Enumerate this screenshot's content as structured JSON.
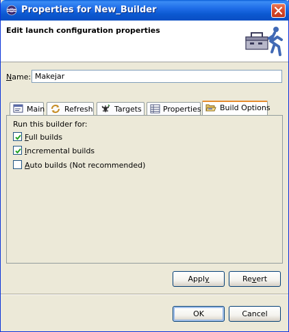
{
  "window": {
    "title": "Properties for New_Builder"
  },
  "header": {
    "title": "Edit launch configuration properties",
    "graphic_icon": "builder-launch-icon"
  },
  "name_field": {
    "label_mnemonic": "N",
    "label_rest": "ame:",
    "value": "Makejar"
  },
  "tabs": [
    {
      "label": "Main",
      "icon": "main-tab-icon",
      "active": false
    },
    {
      "label": "Refresh",
      "icon": "refresh-icon",
      "active": false
    },
    {
      "label": "Targets",
      "icon": "targets-icon",
      "active": false
    },
    {
      "label": "Properties",
      "icon": "properties-icon",
      "active": false
    },
    {
      "label": "Build Options",
      "icon": "folder-open-icon",
      "active": true
    }
  ],
  "build_options": {
    "heading": "Run this builder for:",
    "options": [
      {
        "mnemonic": "F",
        "rest": "ull builds",
        "checked": true
      },
      {
        "mnemonic": "I",
        "rest": "ncremental builds",
        "checked": true
      },
      {
        "mnemonic": "A",
        "rest": "uto builds (Not recommended)",
        "checked": false
      }
    ]
  },
  "buttons": {
    "apply_mnemonic": "y",
    "apply_pre": "Appl",
    "revert_mnemonic": "v",
    "revert_pre": "Re",
    "revert_post": "ert",
    "ok": "OK",
    "cancel": "Cancel"
  },
  "colors": {
    "titlebar": "#0a5fd8",
    "active_tab_accent": "#e68b2c",
    "dialog_bg": "#ece9d8"
  }
}
